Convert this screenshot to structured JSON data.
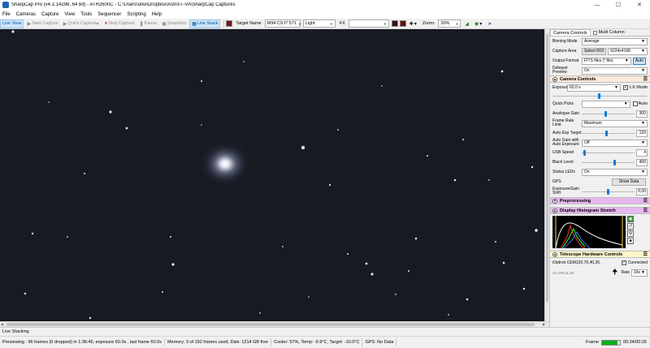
{
  "window": {
    "title": "SharpCap Pro (v4.1.14298, 64 bit) - ATR2600C - C:\\Users\\olivi\\Dropbox\\Astro\\T-VA\\SharpCap Captures"
  },
  "menu": [
    "File",
    "Cameras",
    "Capture",
    "View",
    "Tools",
    "Sequencer",
    "Scripting",
    "Help"
  ],
  "toolbar": {
    "live_view": "Live View",
    "start_capture": "Start Capture",
    "quick_capture": "Quick Capture",
    "stop_capture": "Stop Capture",
    "pause": "Pause",
    "snapshot": "Snapshot",
    "live_stack": "Live Stack",
    "target_name_label": "Target Name",
    "target_name_value": "M94 C9 f7 571",
    "frame_type": "Light",
    "fx_label": "FX",
    "fx_value": "",
    "zoom_label": "Zoom:",
    "zoom_value": "30%",
    "colors": {
      "swatch1": "#3a1010",
      "swatch2": "#5a1414"
    }
  },
  "panel": {
    "tabs": {
      "camera_controls": "Camera Controls",
      "multi_column": "Multi Column"
    },
    "top_rows": {
      "binning_label": "Binning Mode",
      "binning_value": "Average",
      "capture_area_label": "Capture Area",
      "select_roi": "Select ROI",
      "capture_area_value": "6224x4168",
      "output_format_label": "Output Format",
      "output_format_value": "FITS files (*.fits)",
      "auto_btn": "Auto",
      "debayer_label": "Debayer Preview",
      "debayer_value": "On"
    },
    "camera_section": {
      "title": "Camera Controls",
      "exposure_label": "Exposure",
      "exposure_value": "60,0 s",
      "lx_mode": "LX Mode",
      "quick_picks_label": "Quick Picks",
      "auto_label": "Auto",
      "analogue_gain_label": "Analogue Gain",
      "analogue_gain_value": "300",
      "analogue_gain_level": 0.45,
      "frame_rate_label": "Frame Rate Limit",
      "frame_rate_value": "Maximum",
      "auto_exp_label": "Auto Exp Target",
      "auto_exp_value": "120",
      "auto_exp_level": 0.47,
      "auto_gain_label": "Auto Gain with Auto Exposure",
      "auto_gain_value": "Off",
      "usb_speed_label": "USB Speed",
      "usb_speed_value": "4",
      "usb_speed_level": 0.05,
      "black_level_label": "Black Level",
      "black_level_value": "400",
      "black_level_level": 0.62,
      "status_leds_label": "Status LEDs",
      "status_leds_value": "On",
      "gps_label": "GPS",
      "show_data": "Show Data",
      "exposure_shift_label": "Exposure/Gain Shift",
      "exposure_shift_value": "0,00",
      "exposure_shift_level": 0.5
    },
    "preprocessing_title": "Preprocessing",
    "histogram_title": "Display Histogram Stretch",
    "telescope_section": {
      "title": "Telescope Hardware Controls",
      "mount": "iOptron CEM120,70,40,26,",
      "connected": "Connected",
      "rate_label": "Rate",
      "rate_value": "16x",
      "coords": "Az  276.11.18"
    }
  },
  "status": {
    "mode": "Live Stacking",
    "previewing": "Previewing : 96 frames (0 dropped) in 1:36:45, exposure 60.0s , last frame 60.0s",
    "memory": "Memory: 3 of 192 frames used, Disk: 1214 GB free",
    "cooler": "Cooler: 57%, Temp: -9.9°C, Target: -10.0°C",
    "gps": "GPS: No Data",
    "frame_label": "Frame",
    "frame_progress": 0.85,
    "timer": "00:34/00:26"
  }
}
